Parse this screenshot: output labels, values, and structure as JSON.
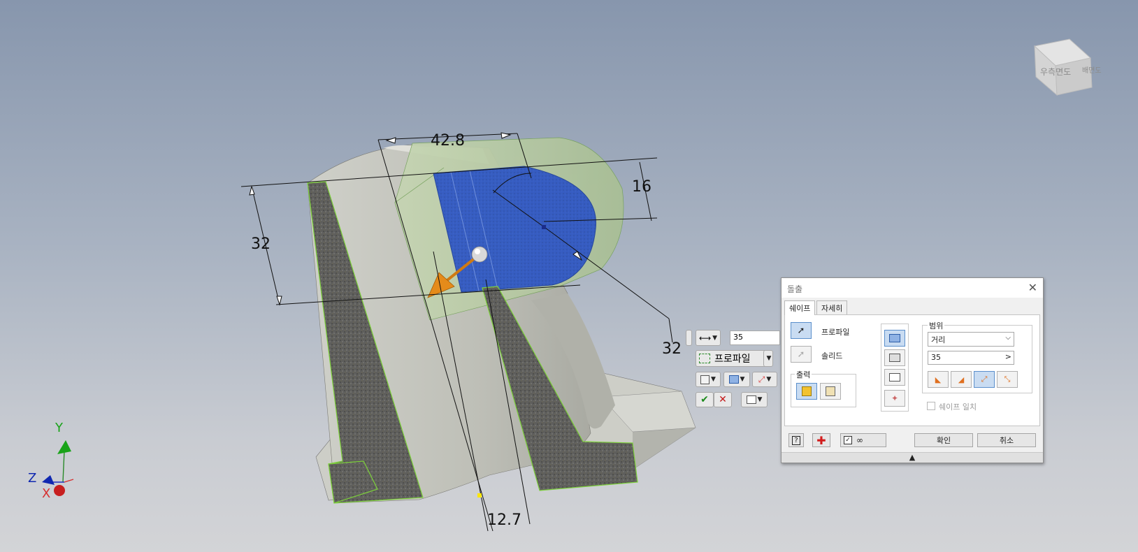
{
  "viewport": {
    "dimensions": {
      "top": "42.8",
      "right": "16",
      "left": "32",
      "bottom_right": "32",
      "bottom": "12.7"
    },
    "viewcube": {
      "face_front": "우측면도",
      "face_side": "배면도"
    },
    "axes": {
      "y": "Y",
      "z": "Z",
      "x": "X"
    }
  },
  "mini_toolbar": {
    "distance_value": "35",
    "profile_label": "프로파일"
  },
  "dialog": {
    "title": "돌출",
    "close_icon": "close-icon",
    "tabs": [
      "쉐이프",
      "자세히"
    ],
    "profile_label": "프로파일",
    "solid_label": "솔리드",
    "output_label": "출력",
    "extent": {
      "label": "범위",
      "type_value": "거리",
      "distance_value": "35",
      "arrow": ">"
    },
    "match_shape_label": "쉐이프 일치",
    "ok_label": "확인",
    "cancel_label": "취소",
    "expand_arrow": "▲"
  },
  "colors": {
    "profile_fill": "#2e56c4",
    "section_edge": "#7cd03a",
    "direction_arrow": "#e58b1a",
    "body": "#c9cbc3",
    "preview": "#b7cca6"
  }
}
